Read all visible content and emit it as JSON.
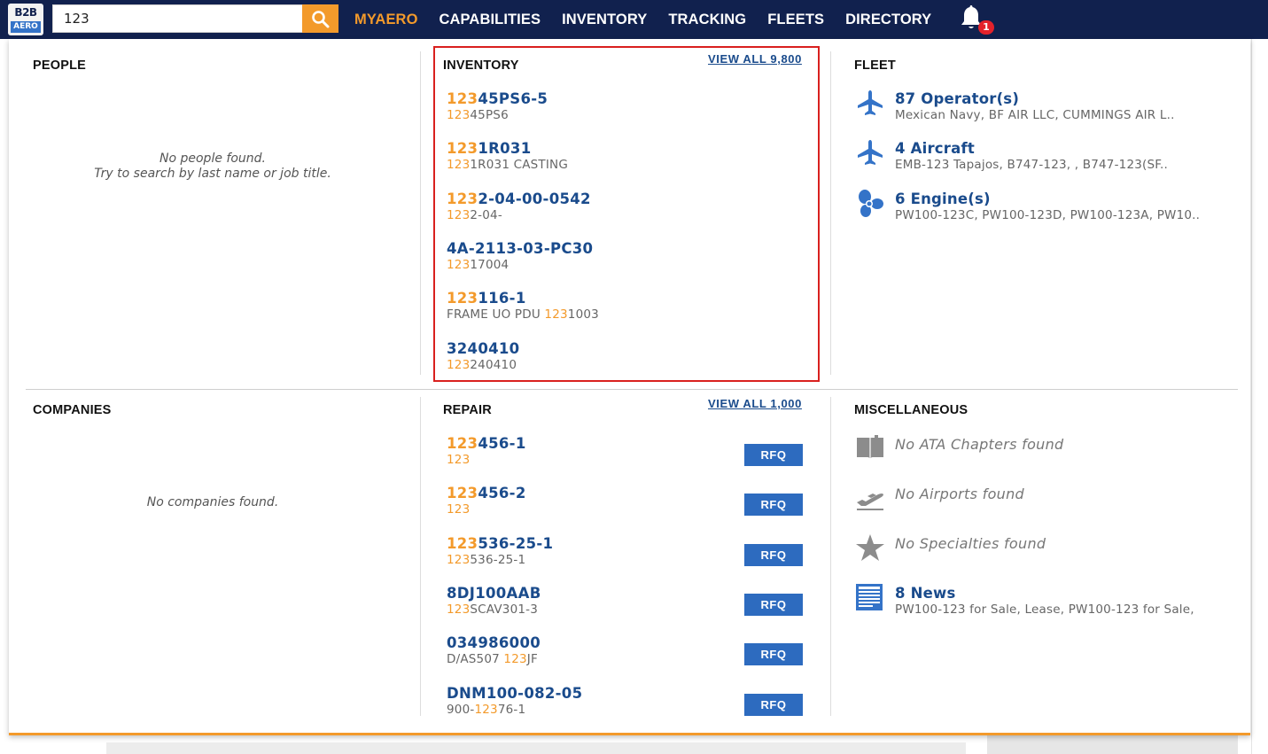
{
  "header": {
    "logo_top": "B2B",
    "logo_bottom": "AERO",
    "search_value": "123",
    "nav": [
      "MYAERO",
      "CAPABILITIES",
      "INVENTORY",
      "TRACKING",
      "FLEETS",
      "DIRECTORY"
    ],
    "notification_count": "1"
  },
  "people": {
    "title": "PEOPLE",
    "empty_line1": "No people found.",
    "empty_line2": "Try to search by last name or job title."
  },
  "inventory": {
    "title": "INVENTORY",
    "view_all": "VIEW ALL 9,800",
    "items": [
      {
        "pn_hl": "123",
        "pn_rest": "45PS6-5",
        "desc_pre": "",
        "desc_hl": "123",
        "desc_rest": "45PS6"
      },
      {
        "pn_hl": "123",
        "pn_rest": "1R031",
        "desc_pre": "",
        "desc_hl": "123",
        "desc_rest": "1R031 CASTING"
      },
      {
        "pn_hl": "123",
        "pn_rest": "2-04-00-0542",
        "desc_pre": "",
        "desc_hl": "123",
        "desc_rest": "2-04-"
      },
      {
        "pn_hl": "",
        "pn_rest": "4A-2113-03-PC30",
        "desc_pre": "",
        "desc_hl": "123",
        "desc_rest": "17004"
      },
      {
        "pn_hl": "123",
        "pn_rest": "116-1",
        "desc_pre": "FRAME UO PDU ",
        "desc_hl": "123",
        "desc_rest": "1003"
      },
      {
        "pn_hl": "",
        "pn_rest": "3240410",
        "desc_pre": "",
        "desc_hl": "123",
        "desc_rest": "240410"
      }
    ]
  },
  "fleet": {
    "title": "FLEET",
    "items": [
      {
        "icon": "airplane-icon",
        "title": "87 Operator(s)",
        "sub": "Mexican Navy, BF AIR LLC, CUMMINGS AIR L.."
      },
      {
        "icon": "airplane-icon",
        "title": "4 Aircraft",
        "sub": "EMB-123 Tapajos, B747-123, , B747-123(SF.."
      },
      {
        "icon": "engine-fan-icon",
        "title": "6 Engine(s)",
        "sub": "PW100-123C, PW100-123D, PW100-123A, PW10.."
      }
    ]
  },
  "companies": {
    "title": "COMPANIES",
    "empty": "No companies found."
  },
  "repair": {
    "title": "REPAIR",
    "view_all": "VIEW ALL 1,000",
    "rfq_label": "RFQ",
    "items": [
      {
        "pn_hl": "123",
        "pn_rest": "456-1",
        "desc_pre": "",
        "desc_hl": "123",
        "desc_rest": ""
      },
      {
        "pn_hl": "123",
        "pn_rest": "456-2",
        "desc_pre": "",
        "desc_hl": "123",
        "desc_rest": ""
      },
      {
        "pn_hl": "123",
        "pn_rest": "536-25-1",
        "desc_pre": "",
        "desc_hl": "123",
        "desc_rest": "536-25-1"
      },
      {
        "pn_hl": "",
        "pn_rest": "8DJ100AAB",
        "desc_pre": "",
        "desc_hl": "123",
        "desc_rest": "SCAV301-3"
      },
      {
        "pn_hl": "",
        "pn_rest": "034986000",
        "desc_pre": "D/AS507 ",
        "desc_hl": "123",
        "desc_rest": "JF"
      },
      {
        "pn_hl": "",
        "pn_rest": "DNM100-082-05",
        "desc_pre": "900-",
        "desc_hl": "123",
        "desc_rest": "76-1"
      }
    ]
  },
  "misc": {
    "title": "MISCELLANEOUS",
    "ata": "No ATA Chapters found",
    "airports": "No Airports found",
    "specialties": "No Specialties found",
    "news_title": "8 News",
    "news_sub": "PW100-123 for Sale, Lease, PW100-123 for Sale,"
  },
  "colors": {
    "navbar": "#11214e",
    "accent": "#f39a2b",
    "link": "#1a4b8c",
    "rfq": "#2d6bbf",
    "highlight_box": "#d9201e"
  }
}
